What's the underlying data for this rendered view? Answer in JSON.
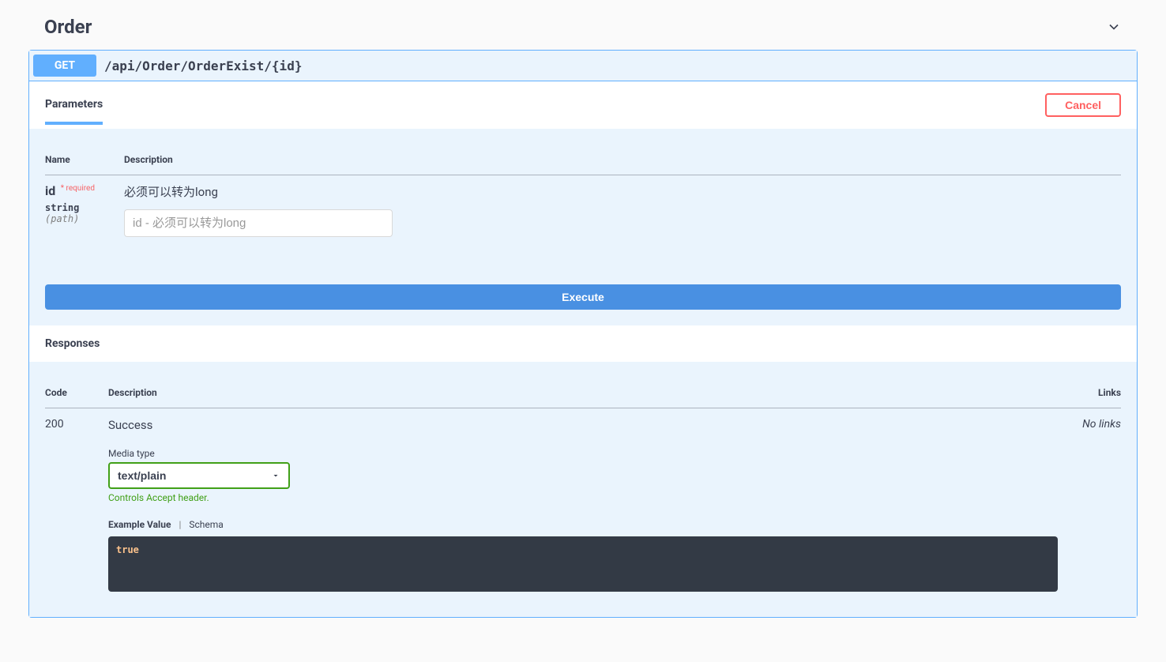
{
  "section": {
    "title": "Order"
  },
  "op": {
    "method": "GET",
    "path": "/api/Order/OrderExist/{id}"
  },
  "tabs": {
    "parameters": "Parameters"
  },
  "buttons": {
    "cancel": "Cancel",
    "execute": "Execute"
  },
  "param_headers": {
    "name": "Name",
    "description": "Description"
  },
  "params": [
    {
      "name": "id",
      "required_label": "* required",
      "type": "string",
      "in": "(path)",
      "description": "必须可以转为long",
      "placeholder": "id - 必须可以转为long"
    }
  ],
  "responses": {
    "title": "Responses",
    "headers": {
      "code": "Code",
      "description": "Description",
      "links": "Links"
    },
    "rows": [
      {
        "code": "200",
        "description": "Success",
        "media_label": "Media type",
        "media_value": "text/plain",
        "media_hint": "Controls Accept header.",
        "example_label": "Example Value",
        "schema_label": "Schema",
        "example_body": "true",
        "links": "No links"
      }
    ]
  }
}
